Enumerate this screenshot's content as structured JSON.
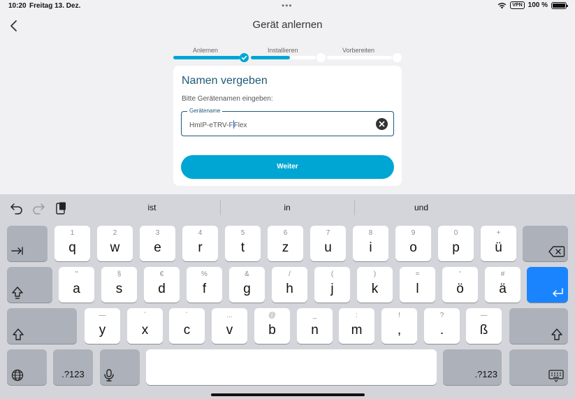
{
  "status_bar": {
    "time": "10:20",
    "date": "Freitag 13. Dez.",
    "dots": "•••",
    "vpn": "VPN",
    "battery": "100 %"
  },
  "header": {
    "title": "Gerät anlernen",
    "back_icon": "chevron-left-icon"
  },
  "steps": [
    {
      "label": "Anlernen",
      "completed": true
    },
    {
      "label": "Installieren",
      "progress": 0.6
    },
    {
      "label": "Vorbereiten",
      "progress": 0
    }
  ],
  "card": {
    "title": "Namen vergeben",
    "prompt": "Bitte Gerätenamen eingeben:",
    "field": {
      "label": "Gerätename",
      "value_before_cursor": "HmIP-eTRV-F",
      "value_after_cursor": "Flex"
    },
    "button": "Weiter"
  },
  "keyboard": {
    "suggestions": [
      "ist",
      "in",
      "und"
    ],
    "row1": [
      {
        "alt": "1",
        "main": "q"
      },
      {
        "alt": "2",
        "main": "w"
      },
      {
        "alt": "3",
        "main": "e"
      },
      {
        "alt": "4",
        "main": "r"
      },
      {
        "alt": "5",
        "main": "t"
      },
      {
        "alt": "6",
        "main": "z"
      },
      {
        "alt": "7",
        "main": "u"
      },
      {
        "alt": "8",
        "main": "i"
      },
      {
        "alt": "9",
        "main": "o"
      },
      {
        "alt": "0",
        "main": "p"
      },
      {
        "alt": "+",
        "main": "ü"
      }
    ],
    "row2": [
      {
        "alt": "\"",
        "main": "a"
      },
      {
        "alt": "§",
        "main": "s"
      },
      {
        "alt": "€",
        "main": "d"
      },
      {
        "alt": "%",
        "main": "f"
      },
      {
        "alt": "&",
        "main": "g"
      },
      {
        "alt": "/",
        "main": "h"
      },
      {
        "alt": "(",
        "main": "j"
      },
      {
        "alt": ")",
        "main": "k"
      },
      {
        "alt": "=",
        "main": "l"
      },
      {
        "alt": "'",
        "main": "ö"
      },
      {
        "alt": "#",
        "main": "ä"
      }
    ],
    "row3": [
      {
        "alt": "—",
        "main": "y"
      },
      {
        "alt": "`",
        "main": "x"
      },
      {
        "alt": "´",
        "main": "c"
      },
      {
        "alt": "...",
        "main": "v"
      },
      {
        "alt": "@",
        "main": "b"
      },
      {
        "alt": "_",
        "main": "n"
      },
      {
        "alt": ":",
        "main": "m"
      },
      {
        "alt": "!",
        "main": ","
      },
      {
        "alt": "?",
        "main": "."
      },
      {
        "alt": "—",
        "main": "ß"
      }
    ],
    "numbers_label": ".?123"
  }
}
